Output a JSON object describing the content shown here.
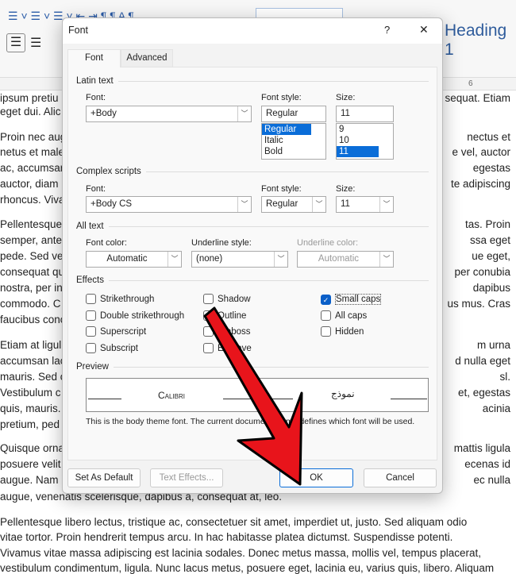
{
  "ribbon": {
    "heading_style": "Heading 1",
    "ruler_number": "6"
  },
  "document": {
    "partial_lines": [
      [
        "ipsum pretiu",
        "sequat. Etiam"
      ],
      [
        "eget dui. Alic",
        ""
      ],
      [
        "Proin nec aug",
        "nectus et"
      ],
      [
        "netus et male",
        "e vel, auctor"
      ],
      [
        "ac, accumsan",
        "egestas"
      ],
      [
        "auctor, diam",
        "te adipiscing"
      ],
      [
        "rhoncus. Viva",
        ""
      ],
      [
        "Pellentesque",
        "tas. Proin"
      ],
      [
        "semper, ante",
        "ssa eget"
      ],
      [
        "pede. Sed ve",
        "ue eget,"
      ],
      [
        "consequat qu",
        "per conubia"
      ],
      [
        "nostra, per in",
        "dapibus"
      ],
      [
        "commodo. C",
        "us mus. Cras"
      ],
      [
        "faucibus conc",
        ""
      ],
      [
        "Etiam at ligul",
        "m urna"
      ],
      [
        "accumsan lac",
        "d nulla eget"
      ],
      [
        "mauris. Sed c",
        "sl."
      ],
      [
        "Vestibulum c",
        "et, egestas"
      ],
      [
        "quis, mauris.",
        "acinia"
      ],
      [
        "pretium, ped",
        ""
      ],
      [
        "Quisque orna",
        "mattis ligula"
      ],
      [
        "posuere velit",
        "ecenas id"
      ],
      [
        "augue. Nam",
        "ec nulla"
      ]
    ],
    "full_lines": [
      "augue, venenatis scelerisque, dapibus a, consequat at, leo.",
      "Pellentesque libero lectus, tristique ac, consectetuer sit amet, imperdiet ut, justo. Sed aliquam odio",
      "vitae tortor. Proin hendrerit tempus arcu. In hac habitasse platea dictumst. Suspendisse potenti.",
      "Vivamus vitae massa adipiscing est lacinia sodales. Donec metus massa, mollis vel, tempus placerat,",
      "vestibulum condimentum, ligula. Nunc lacus metus, posuere eget, lacinia eu, varius quis, libero. Aliquam"
    ]
  },
  "dialog": {
    "title": "Font",
    "help": "?",
    "close": "✕",
    "tabs": [
      "Font",
      "Advanced"
    ],
    "latin": {
      "group": "Latin text",
      "font_label": "Font:",
      "font_value": "+Body",
      "style_label": "Font style:",
      "style_value": "Regular",
      "styles": [
        "Regular",
        "Italic",
        "Bold"
      ],
      "size_label": "Size:",
      "size_value": "11",
      "sizes": [
        "9",
        "10",
        "11"
      ]
    },
    "complex": {
      "group": "Complex scripts",
      "font_label": "Font:",
      "font_value": "+Body CS",
      "style_label": "Font style:",
      "style_value": "Regular",
      "size_label": "Size:",
      "size_value": "11"
    },
    "all_text": {
      "group": "All text",
      "color_label": "Font color:",
      "color_value": "Automatic",
      "underline_label": "Underline style:",
      "underline_value": "(none)",
      "ucolor_label": "Underline color:",
      "ucolor_value": "Automatic"
    },
    "effects": {
      "group": "Effects",
      "items": [
        {
          "label": "Strikethrough",
          "checked": false
        },
        {
          "label": "Double strikethrough",
          "checked": false
        },
        {
          "label": "Superscript",
          "checked": false
        },
        {
          "label": "Subscript",
          "checked": false
        },
        {
          "label": "Shadow",
          "checked": false
        },
        {
          "label": "Outline",
          "checked": false
        },
        {
          "label": "Emboss",
          "checked": false
        },
        {
          "label": "Engrave",
          "checked": false
        },
        {
          "label": "Small caps",
          "checked": true
        },
        {
          "label": "All caps",
          "checked": false
        },
        {
          "label": "Hidden",
          "checked": false
        }
      ]
    },
    "preview": {
      "group": "Preview",
      "latin_sample": "Calibri",
      "arabic_sample": "نموذج",
      "description": "This is the body theme font. The current document theme defines which font will be used."
    },
    "buttons": {
      "set_default": "Set As Default",
      "text_effects": "Text Effects...",
      "ok": "OK",
      "cancel": "Cancel"
    }
  },
  "colors": {
    "accent": "#0a6dd8",
    "arrow": "#e8141b"
  }
}
